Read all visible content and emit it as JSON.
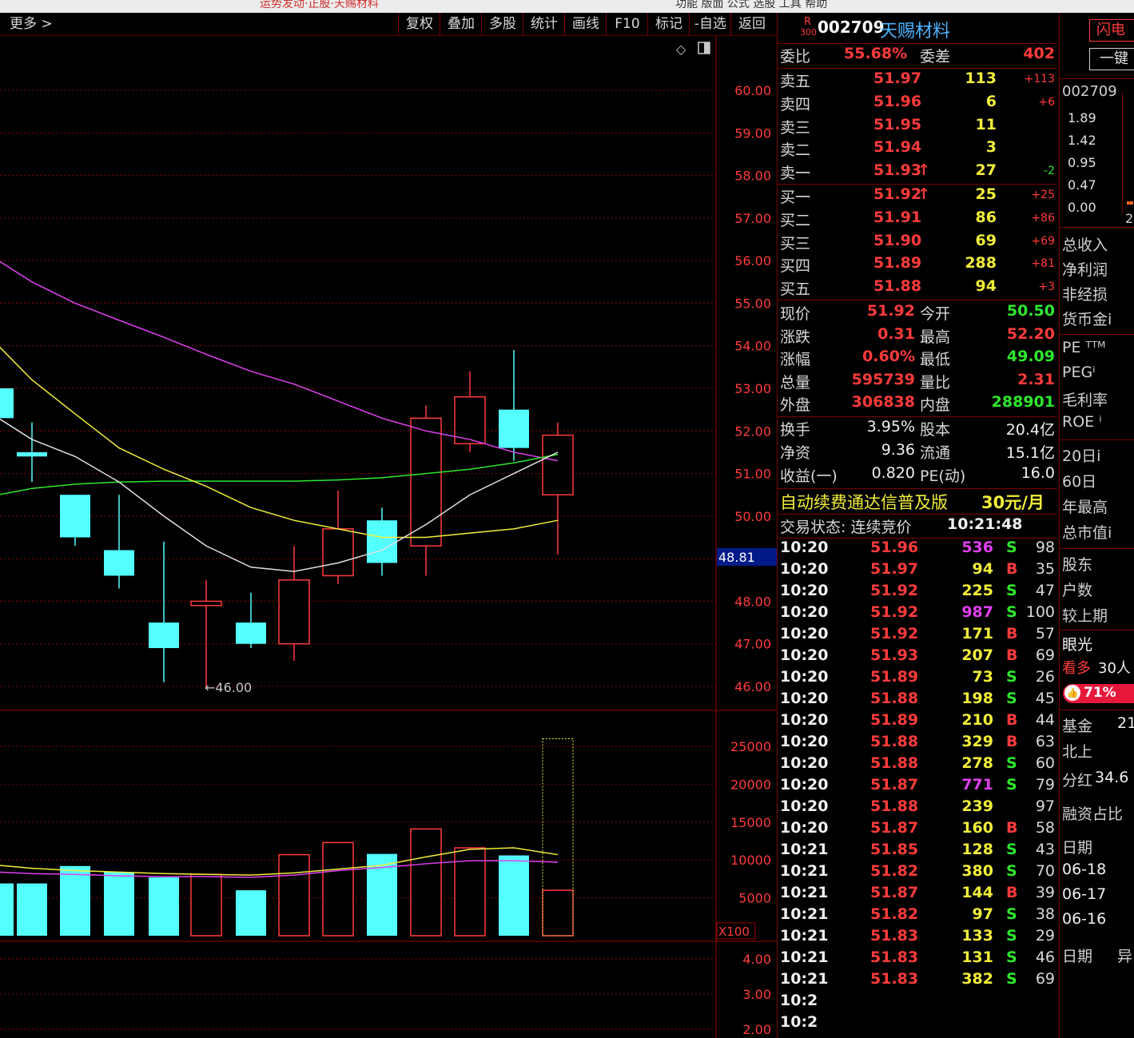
{
  "top_strip": {
    "left_text": "运势发动·正股·天赐材料",
    "right_text": "功能 版面 公式 选股 工具 帮助"
  },
  "toolbar": {
    "more_label": "更多 >",
    "buttons": [
      "复权",
      "叠加",
      "多股",
      "统计",
      "画线",
      "F10",
      "标记",
      "-自选",
      "返回"
    ]
  },
  "kline": {
    "price_axis_ticks": [
      "60.00",
      "59.00",
      "58.00",
      "57.00",
      "56.00",
      "55.00",
      "54.00",
      "53.00",
      "52.00",
      "51.00",
      "50.00",
      "49.00",
      "48.00",
      "47.00",
      "46.00"
    ],
    "current_price_marker": "48.81",
    "low_label": "←46.00",
    "candles": [
      {
        "o": 53.0,
        "c": 52.3,
        "h": 53.0,
        "l": 52.3
      },
      {
        "o": 51.5,
        "c": 51.4,
        "h": 52.2,
        "l": 50.8
      },
      {
        "o": 50.5,
        "c": 49.5,
        "h": 50.5,
        "l": 49.3
      },
      {
        "o": 49.2,
        "c": 48.6,
        "h": 50.5,
        "l": 48.3
      },
      {
        "o": 47.5,
        "c": 46.9,
        "h": 49.4,
        "l": 46.1
      },
      {
        "o": 47.9,
        "c": 48.0,
        "h": 48.5,
        "l": 46.0
      },
      {
        "o": 47.5,
        "c": 47.0,
        "h": 48.2,
        "l": 46.9
      },
      {
        "o": 47.0,
        "c": 48.5,
        "h": 49.3,
        "l": 46.6
      },
      {
        "o": 48.6,
        "c": 49.7,
        "h": 50.6,
        "l": 48.4
      },
      {
        "o": 49.9,
        "c": 48.9,
        "h": 50.2,
        "l": 48.6
      },
      {
        "o": 49.3,
        "c": 52.3,
        "h": 52.6,
        "l": 48.6
      },
      {
        "o": 51.7,
        "c": 52.8,
        "h": 53.4,
        "l": 51.5
      },
      {
        "o": 52.5,
        "c": 51.6,
        "h": 53.9,
        "l": 51.3
      },
      {
        "o": 50.5,
        "c": 51.9,
        "h": 52.2,
        "l": 49.1
      }
    ],
    "ma_white": [
      52.3,
      51.8,
      51.4,
      50.8,
      50.0,
      49.3,
      48.8,
      48.7,
      48.9,
      49.2,
      49.8,
      50.5,
      51.0,
      51.5
    ],
    "ma_yellow": [
      54.0,
      53.2,
      52.4,
      51.6,
      51.1,
      50.7,
      50.2,
      49.9,
      49.7,
      49.5,
      49.5,
      49.6,
      49.7,
      49.9
    ],
    "ma_magenta": [
      56.0,
      55.5,
      55.0,
      54.6,
      54.2,
      53.8,
      53.4,
      53.1,
      52.7,
      52.3,
      52.0,
      51.8,
      51.5,
      51.3
    ],
    "ma_green": [
      50.5,
      50.65,
      50.75,
      50.8,
      50.82,
      50.82,
      50.82,
      50.82,
      50.85,
      50.9,
      51.0,
      51.1,
      51.25,
      51.45
    ]
  },
  "volume": {
    "axis_ticks": [
      "25000",
      "20000",
      "15000",
      "10000",
      "5000"
    ],
    "multiplier": "X100",
    "bars": [
      6900,
      6900,
      9200,
      8400,
      7700,
      8100,
      6000,
      10700,
      12300,
      10800,
      14100,
      11600,
      10600,
      6000
    ],
    "current_total": 26000,
    "ma_yellow": [
      9300,
      8900,
      8600,
      8400,
      8200,
      8100,
      8000,
      8300,
      8800,
      9300,
      10400,
      11400,
      11600,
      10700
    ],
    "ma_magenta": [
      8400,
      8200,
      8100,
      7900,
      7800,
      7800,
      7700,
      8000,
      8600,
      9000,
      9500,
      9900,
      9900,
      9700
    ]
  },
  "indicator": {
    "axis_ticks": [
      "4.00",
      "3.00",
      "2.00"
    ]
  },
  "quote": {
    "prefix": "R",
    "prefix_sub": "300",
    "code": "002709",
    "name": "天赐材料",
    "weibi_label": "委比",
    "weibi_value": "55.68%",
    "weicha_label": "委差",
    "weicha_value": "402",
    "asks": [
      {
        "label": "卖五",
        "price": "51.97",
        "vol": "113",
        "chg": "+113",
        "arrow": ""
      },
      {
        "label": "卖四",
        "price": "51.96",
        "vol": "6",
        "chg": "+6",
        "arrow": ""
      },
      {
        "label": "卖三",
        "price": "51.95",
        "vol": "11",
        "chg": "",
        "arrow": ""
      },
      {
        "label": "卖二",
        "price": "51.94",
        "vol": "3",
        "chg": "",
        "arrow": ""
      },
      {
        "label": "卖一",
        "price": "51.93",
        "vol": "27",
        "chg": "-2",
        "arrow": "🠕"
      }
    ],
    "bids": [
      {
        "label": "买一",
        "price": "51.92",
        "vol": "25",
        "chg": "+25",
        "arrow": "🠕"
      },
      {
        "label": "买二",
        "price": "51.91",
        "vol": "86",
        "chg": "+86",
        "arrow": ""
      },
      {
        "label": "买三",
        "price": "51.90",
        "vol": "69",
        "chg": "+69",
        "arrow": ""
      },
      {
        "label": "买四",
        "price": "51.89",
        "vol": "288",
        "chg": "+81",
        "arrow": ""
      },
      {
        "label": "买五",
        "price": "51.88",
        "vol": "94",
        "chg": "+3",
        "arrow": ""
      }
    ],
    "stats": [
      {
        "l1": "现价",
        "v1": "51.92",
        "l2": "今开",
        "v2": "50.50",
        "c2": "grn"
      },
      {
        "l1": "涨跌",
        "v1": "0.31",
        "l2": "最高",
        "v2": "52.20",
        "c2": "red"
      },
      {
        "l1": "涨幅",
        "v1": "0.60%",
        "l2": "最低",
        "v2": "49.09",
        "c2": "grn"
      },
      {
        "l1": "总量",
        "v1": "595739",
        "l2": "量比",
        "v2": "2.31",
        "c2": "red"
      },
      {
        "l1": "外盘",
        "v1": "306838",
        "l2": "内盘",
        "v2": "288901",
        "c2": "grn"
      }
    ],
    "stats2": [
      {
        "l1": "换手",
        "v1": "3.95%",
        "l2": "股本",
        "v2": "20.4亿"
      },
      {
        "l1": "净资",
        "v1": "9.36",
        "l2": "流通",
        "v2": "15.1亿"
      },
      {
        "l1": "收益(一)",
        "v1": "0.820",
        "l2": "PE(动)",
        "v2": "16.0"
      }
    ],
    "promo_text": "自动续费通达信普及版",
    "promo_price": "30元/月",
    "status_label": "交易状态: 连续竞价",
    "status_time": "10:21:48"
  },
  "ticks": [
    {
      "t": "10:20",
      "p": "51.96",
      "v": "536",
      "vc": "mag",
      "s": "S",
      "n": "98"
    },
    {
      "t": "10:20",
      "p": "51.97",
      "v": "94",
      "vc": "yel",
      "s": "B",
      "n": "35"
    },
    {
      "t": "10:20",
      "p": "51.92",
      "v": "225",
      "vc": "yel",
      "s": "S",
      "n": "47"
    },
    {
      "t": "10:20",
      "p": "51.92",
      "v": "987",
      "vc": "mag",
      "s": "S",
      "n": "100"
    },
    {
      "t": "10:20",
      "p": "51.92",
      "v": "171",
      "vc": "yel",
      "s": "B",
      "n": "57"
    },
    {
      "t": "10:20",
      "p": "51.93",
      "v": "207",
      "vc": "yel",
      "s": "B",
      "n": "69"
    },
    {
      "t": "10:20",
      "p": "51.89",
      "v": "73",
      "vc": "yel",
      "s": "S",
      "n": "26"
    },
    {
      "t": "10:20",
      "p": "51.88",
      "v": "198",
      "vc": "yel",
      "s": "S",
      "n": "45"
    },
    {
      "t": "10:20",
      "p": "51.89",
      "v": "210",
      "vc": "yel",
      "s": "B",
      "n": "44"
    },
    {
      "t": "10:20",
      "p": "51.88",
      "v": "329",
      "vc": "yel",
      "s": "B",
      "n": "63"
    },
    {
      "t": "10:20",
      "p": "51.88",
      "v": "278",
      "vc": "yel",
      "s": "S",
      "n": "60"
    },
    {
      "t": "10:20",
      "p": "51.87",
      "v": "771",
      "vc": "mag",
      "s": "S",
      "n": "79"
    },
    {
      "t": "10:20",
      "p": "51.88",
      "v": "239",
      "vc": "yel",
      "s": "",
      "n": "97"
    },
    {
      "t": "10:20",
      "p": "51.87",
      "v": "160",
      "vc": "yel",
      "s": "B",
      "n": "58"
    },
    {
      "t": "10:21",
      "p": "51.85",
      "v": "128",
      "vc": "yel",
      "s": "S",
      "n": "43"
    },
    {
      "t": "10:21",
      "p": "51.82",
      "v": "380",
      "vc": "yel",
      "s": "S",
      "n": "70"
    },
    {
      "t": "10:21",
      "p": "51.87",
      "v": "144",
      "vc": "yel",
      "s": "B",
      "n": "39"
    },
    {
      "t": "10:21",
      "p": "51.82",
      "v": "97",
      "vc": "yel",
      "s": "S",
      "n": "38"
    },
    {
      "t": "10:21",
      "p": "51.83",
      "v": "133",
      "vc": "yel",
      "s": "S",
      "n": "29"
    },
    {
      "t": "10:21",
      "p": "51.83",
      "v": "131",
      "vc": "yel",
      "s": "S",
      "n": "46"
    },
    {
      "t": "10:21",
      "p": "51.83",
      "v": "382",
      "vc": "yel",
      "s": "S",
      "n": "69"
    },
    {
      "t": "10:2",
      "p": "",
      "v": "",
      "vc": "yel",
      "s": "",
      "n": ""
    },
    {
      "t": "10:2",
      "p": "",
      "v": "",
      "vc": "yel",
      "s": "",
      "n": ""
    }
  ],
  "side": {
    "flash_btn": "闪电",
    "one_key_btn": "一键",
    "code": "002709",
    "mini_ticks": [
      "1.89",
      "1.42",
      "0.95",
      "0.47",
      "0.00"
    ],
    "mini_tick_tail": "2",
    "fin_labels": [
      "总收入",
      "净利润",
      "非经损",
      "货币金i"
    ],
    "ratio_labels": [
      "PE ᵀᵀᴹ",
      "PEGⁱ",
      "毛利率",
      "ROE ⁱ"
    ],
    "period_labels": [
      "20日i",
      "60日",
      "年最高",
      "总市值i"
    ],
    "holder_labels": [
      "股东",
      "户数",
      "较上期"
    ],
    "eye_label": "眼光",
    "bull_label": "看多",
    "bull_count": "30人",
    "bull_pct": "71%",
    "fund_label": "基金",
    "fund_val": "21",
    "north_label": "北上",
    "dividend_label": "分红",
    "dividend_val": "34.6",
    "margin_label": "融资占比",
    "date_header": "日期",
    "dates": [
      "06-18",
      "06-17",
      "06-16"
    ],
    "date_header2": "日期",
    "abnormal": "异"
  },
  "colors": {
    "up": "#ff3b3b",
    "down": "#54ffff",
    "ma_white": "#e0e0e0",
    "ma_yellow": "#f2ee3a",
    "ma_magenta": "#e040f0",
    "ma_green": "#2ee82e",
    "grid": "#8a0000"
  }
}
